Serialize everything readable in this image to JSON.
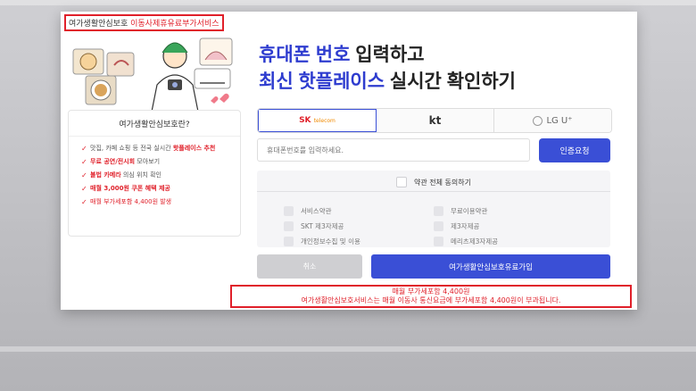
{
  "top_banner": {
    "prefix": "여가생활안심보호",
    "highlight": "이동사제휴유료부가서비스"
  },
  "hero": {
    "line1_highlight": "휴대폰 번호",
    "line1_rest": "입력하고",
    "line2_highlight": "최신 핫플레이스",
    "line2_rest": "실시간 확인하기"
  },
  "info": {
    "title": "여가생활안심보호란?",
    "items": [
      {
        "pre": "맛집, 카페 쇼핑 등 전국 실시간 ",
        "hl": "핫플레이스 추천",
        "post": ""
      },
      {
        "pre": "",
        "hl": "무료 공연/전시회",
        "post": " 모아보기"
      },
      {
        "pre": "",
        "hl": "불법 카메라",
        "post": " 의심 위치 확인"
      },
      {
        "pre": "",
        "hl": "매월 3,000원 쿠폰 혜택 제공",
        "post": ""
      },
      {
        "pre": "매월 부가세포함 4,400원 발생",
        "hl": "",
        "post": ""
      }
    ]
  },
  "carriers": {
    "skt_main": "SK",
    "skt_sub": "telecom",
    "kt": "kt",
    "lgu": "LG U⁺",
    "lgu_icon": "lg-circle-icon"
  },
  "phone": {
    "placeholder": "휴대폰번호를 입력하세요."
  },
  "verify_label": "인증요청",
  "terms": {
    "agree_all": "약관 전체 동의하기",
    "items": [
      "서비스약관",
      "SKT 제3자제공",
      "개인정보수집 및 이용",
      "무료이용약관",
      "제3자제공",
      "메리츠제3자제공"
    ]
  },
  "buttons": {
    "cancel": "취소",
    "join": "여가생활안심보호유료가입"
  },
  "notice": {
    "line1": "매월 부가세포함 4,400원",
    "line2": "여가생활안심보호서비스는 매월 이동사 통신요금에 부가세포함 4,400원이 부과됩니다."
  },
  "colors": {
    "accent_blue": "#3a4fd6",
    "hero_blue": "#2e3ccf",
    "alert_red": "#e0202a"
  }
}
